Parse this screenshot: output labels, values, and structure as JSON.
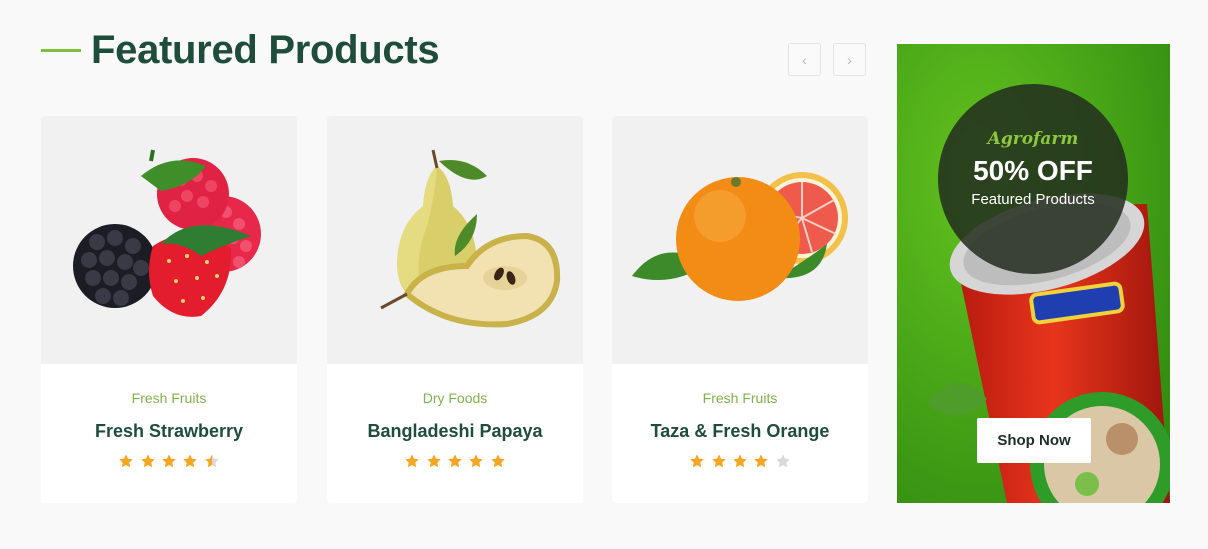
{
  "section": {
    "title": "Featured Products"
  },
  "nav": {
    "prev_icon": "‹",
    "next_icon": "›"
  },
  "products": [
    {
      "category": "Fresh Fruits",
      "name": "Fresh Strawberry",
      "rating": 4.5
    },
    {
      "category": "Dry Foods",
      "name": "Bangladeshi Papaya",
      "rating": 5
    },
    {
      "category": "Fresh Fruits",
      "name": "Taza & Fresh Orange",
      "rating": 4
    }
  ],
  "banner": {
    "brand": "Agrofarm",
    "discount": "50% OFF",
    "subtitle": "Featured Products",
    "button_label": "Shop Now"
  },
  "colors": {
    "accent": "#7fbf3f",
    "heading": "#1f4d3c",
    "category": "#7fb24a",
    "star": "#f5a623",
    "star_empty": "#d9d9d9",
    "banner_green": "#3fa01a"
  }
}
